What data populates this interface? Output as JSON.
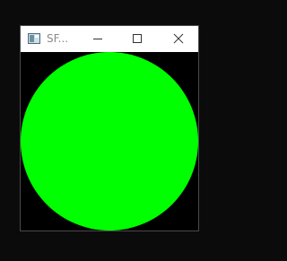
{
  "window": {
    "title": "SF...",
    "titlebar_color": "#ffffff",
    "title_color": "#8a8a8a",
    "border_color": "#4a4a4a",
    "controls": {
      "minimize": "minimize-icon",
      "maximize": "maximize-icon",
      "close": "close-icon"
    }
  },
  "canvas": {
    "background": "#000000",
    "shape": "circle",
    "fill": "#00ff00"
  },
  "desktop": {
    "background": "#0b0b0b"
  }
}
